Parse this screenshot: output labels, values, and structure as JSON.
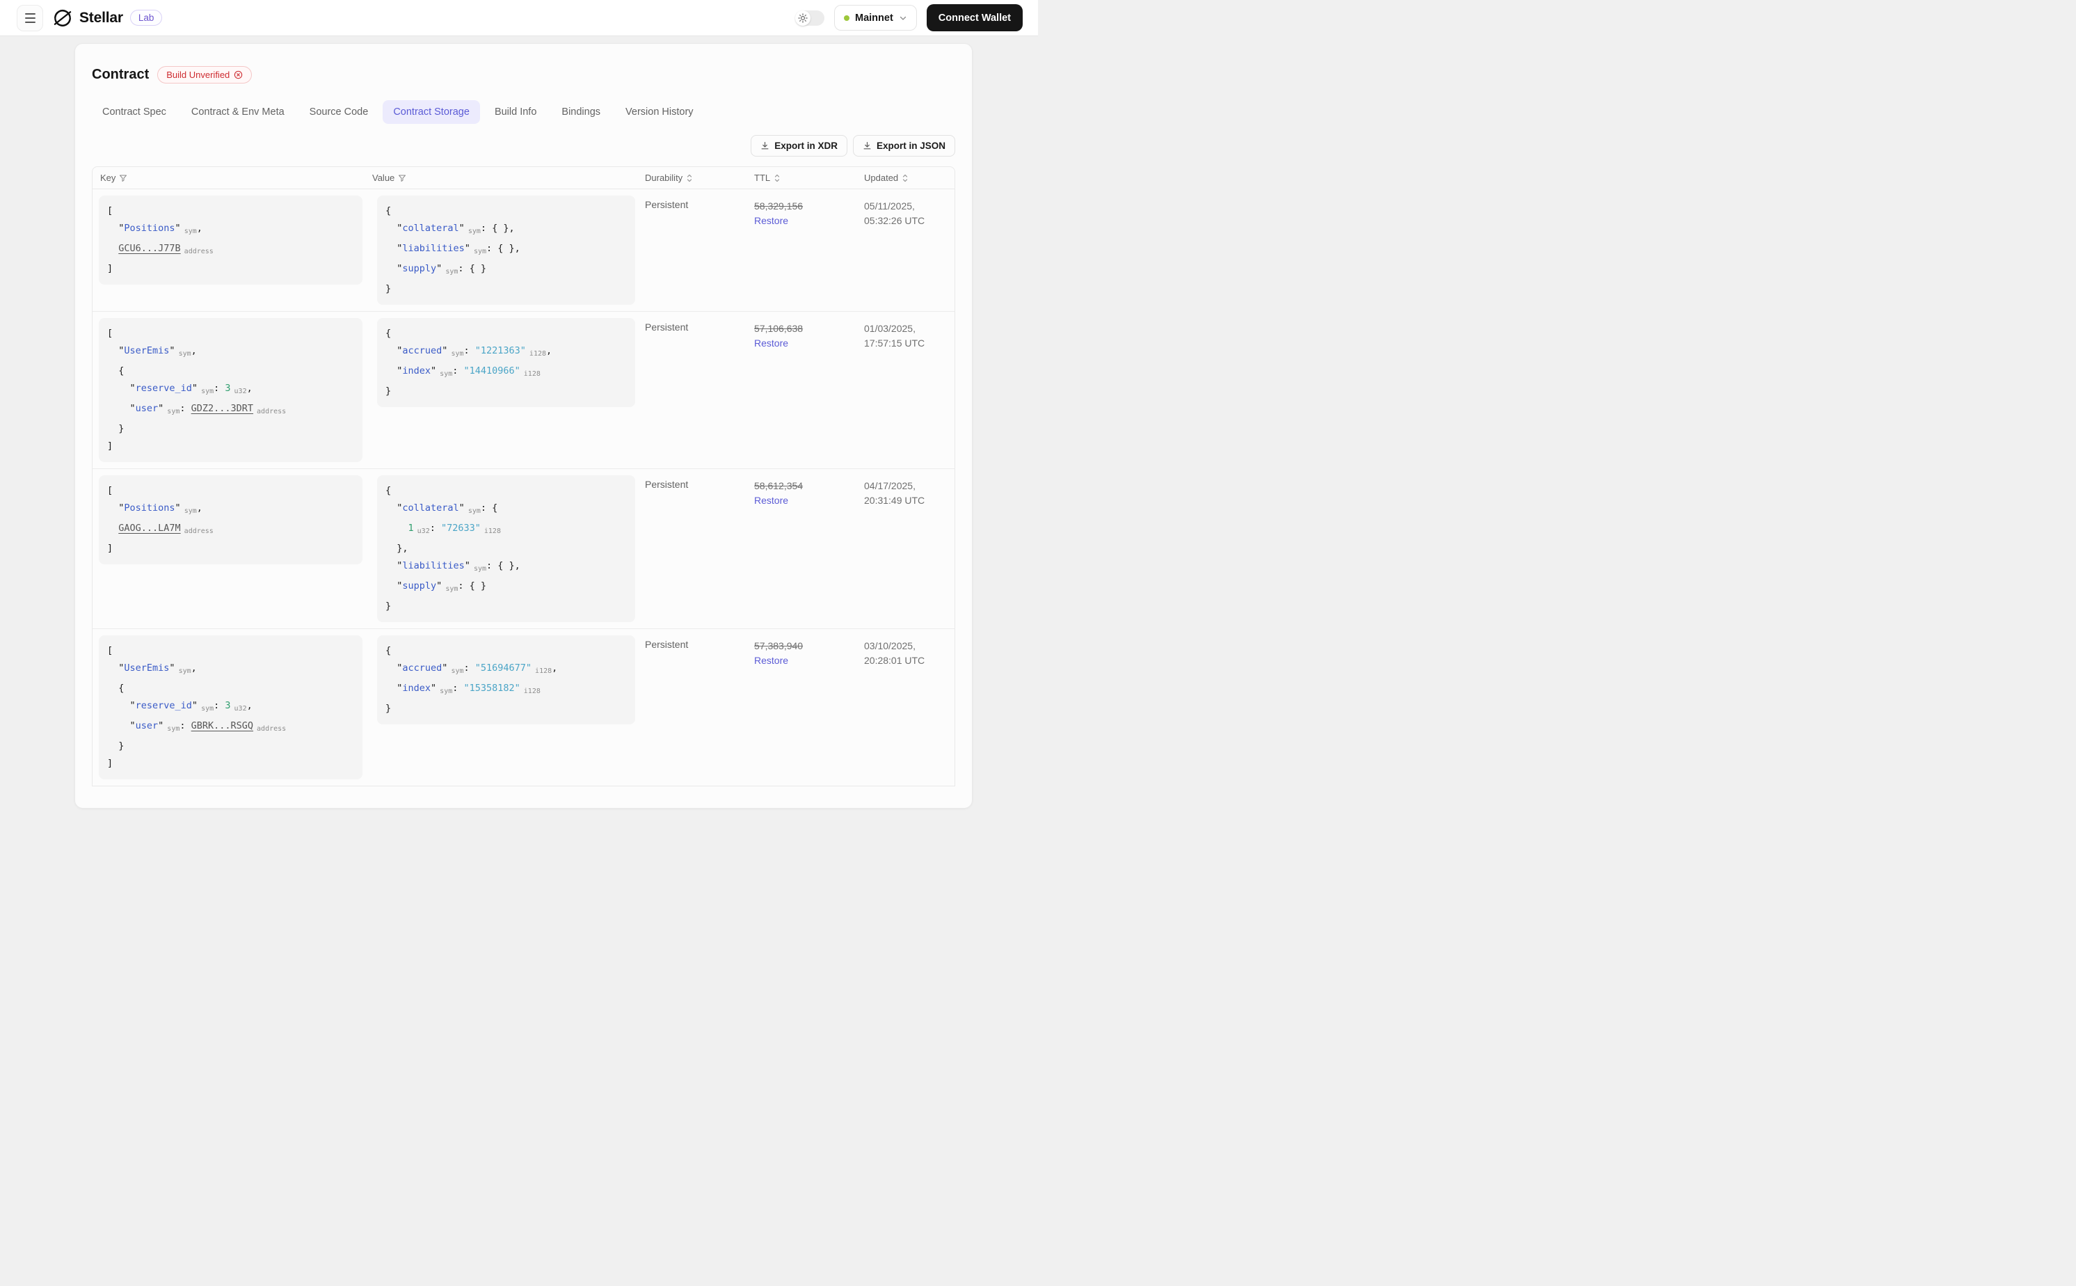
{
  "header": {
    "brand": "Stellar",
    "badge": "Lab",
    "network": {
      "label": "Mainnet",
      "status_color": "#9dc73b"
    },
    "connect_wallet_label": "Connect Wallet"
  },
  "page": {
    "title": "Contract",
    "status_badge": "Build Unverified",
    "tabs": [
      {
        "label": "Contract Spec",
        "active": false
      },
      {
        "label": "Contract & Env Meta",
        "active": false
      },
      {
        "label": "Source Code",
        "active": false
      },
      {
        "label": "Contract Storage",
        "active": true
      },
      {
        "label": "Build Info",
        "active": false
      },
      {
        "label": "Bindings",
        "active": false
      },
      {
        "label": "Version History",
        "active": false
      }
    ],
    "export_buttons": {
      "xdr": "Export in XDR",
      "json": "Export in JSON"
    }
  },
  "colors": {
    "accent_purple": "#5b5bd6",
    "badge_red": "#ce2c31",
    "code_key_blue": "#3a5bc7",
    "code_string_cyan": "#4ba5c7",
    "code_number_green": "#2f9e6e"
  },
  "table": {
    "columns": [
      {
        "label": "Key",
        "icon": "filter"
      },
      {
        "label": "Value",
        "icon": "filter"
      },
      {
        "label": "Durability",
        "icon": "sort"
      },
      {
        "label": "TTL",
        "icon": "sort"
      },
      {
        "label": "Updated",
        "icon": "sort"
      }
    ],
    "rows": [
      {
        "key_lines": [
          [
            {
              "t": "p",
              "v": "["
            }
          ],
          [
            {
              "t": "p",
              "v": "  \""
            },
            {
              "t": "k",
              "v": "Positions"
            },
            {
              "t": "p",
              "v": "\""
            },
            {
              "t": "a",
              "v": "sym"
            },
            {
              "t": "p",
              "v": ","
            }
          ],
          [
            {
              "t": "p",
              "v": "  "
            },
            {
              "t": "link",
              "v": "GCU6...J77B"
            },
            {
              "t": "a",
              "v": "address"
            }
          ],
          [
            {
              "t": "p",
              "v": "]"
            }
          ]
        ],
        "value_lines": [
          [
            {
              "t": "p",
              "v": "{"
            }
          ],
          [
            {
              "t": "p",
              "v": "  \""
            },
            {
              "t": "k",
              "v": "collateral"
            },
            {
              "t": "p",
              "v": "\""
            },
            {
              "t": "a",
              "v": "sym"
            },
            {
              "t": "p",
              "v": ": { },"
            }
          ],
          [
            {
              "t": "p",
              "v": "  \""
            },
            {
              "t": "k",
              "v": "liabilities"
            },
            {
              "t": "p",
              "v": "\""
            },
            {
              "t": "a",
              "v": "sym"
            },
            {
              "t": "p",
              "v": ": { },"
            }
          ],
          [
            {
              "t": "p",
              "v": "  \""
            },
            {
              "t": "k",
              "v": "supply"
            },
            {
              "t": "p",
              "v": "\""
            },
            {
              "t": "a",
              "v": "sym"
            },
            {
              "t": "p",
              "v": ": { }"
            }
          ],
          [
            {
              "t": "p",
              "v": "}"
            }
          ]
        ],
        "durability": "Persistent",
        "ttl": "58,329,156",
        "ttl_action": "Restore",
        "updated": [
          "05/11/2025,",
          "05:32:26 UTC"
        ]
      },
      {
        "key_lines": [
          [
            {
              "t": "p",
              "v": "["
            }
          ],
          [
            {
              "t": "p",
              "v": "  \""
            },
            {
              "t": "k",
              "v": "UserEmis"
            },
            {
              "t": "p",
              "v": "\""
            },
            {
              "t": "a",
              "v": "sym"
            },
            {
              "t": "p",
              "v": ","
            }
          ],
          [
            {
              "t": "p",
              "v": "  {"
            }
          ],
          [
            {
              "t": "p",
              "v": "    \""
            },
            {
              "t": "k",
              "v": "reserve_id"
            },
            {
              "t": "p",
              "v": "\""
            },
            {
              "t": "a",
              "v": "sym"
            },
            {
              "t": "p",
              "v": ": "
            },
            {
              "t": "n",
              "v": "3"
            },
            {
              "t": "a",
              "v": "u32"
            },
            {
              "t": "p",
              "v": ","
            }
          ],
          [
            {
              "t": "p",
              "v": "    \""
            },
            {
              "t": "k",
              "v": "user"
            },
            {
              "t": "p",
              "v": "\""
            },
            {
              "t": "a",
              "v": "sym"
            },
            {
              "t": "p",
              "v": ": "
            },
            {
              "t": "link",
              "v": "GDZ2...3DRT"
            },
            {
              "t": "a",
              "v": "address"
            }
          ],
          [
            {
              "t": "p",
              "v": "  }"
            }
          ],
          [
            {
              "t": "p",
              "v": "]"
            }
          ]
        ],
        "value_lines": [
          [
            {
              "t": "p",
              "v": "{"
            }
          ],
          [
            {
              "t": "p",
              "v": "  \""
            },
            {
              "t": "k",
              "v": "accrued"
            },
            {
              "t": "p",
              "v": "\""
            },
            {
              "t": "a",
              "v": "sym"
            },
            {
              "t": "p",
              "v": ": "
            },
            {
              "t": "s",
              "v": "\"1221363\""
            },
            {
              "t": "a",
              "v": "i128"
            },
            {
              "t": "p",
              "v": ","
            }
          ],
          [
            {
              "t": "p",
              "v": "  \""
            },
            {
              "t": "k",
              "v": "index"
            },
            {
              "t": "p",
              "v": "\""
            },
            {
              "t": "a",
              "v": "sym"
            },
            {
              "t": "p",
              "v": ": "
            },
            {
              "t": "s",
              "v": "\"14410966\""
            },
            {
              "t": "a",
              "v": "i128"
            }
          ],
          [
            {
              "t": "p",
              "v": "}"
            }
          ]
        ],
        "durability": "Persistent",
        "ttl": "57,106,638",
        "ttl_action": "Restore",
        "updated": [
          "01/03/2025,",
          "17:57:15 UTC"
        ]
      },
      {
        "key_lines": [
          [
            {
              "t": "p",
              "v": "["
            }
          ],
          [
            {
              "t": "p",
              "v": "  \""
            },
            {
              "t": "k",
              "v": "Positions"
            },
            {
              "t": "p",
              "v": "\""
            },
            {
              "t": "a",
              "v": "sym"
            },
            {
              "t": "p",
              "v": ","
            }
          ],
          [
            {
              "t": "p",
              "v": "  "
            },
            {
              "t": "link",
              "v": "GAOG...LA7M"
            },
            {
              "t": "a",
              "v": "address"
            }
          ],
          [
            {
              "t": "p",
              "v": "]"
            }
          ]
        ],
        "value_lines": [
          [
            {
              "t": "p",
              "v": "{"
            }
          ],
          [
            {
              "t": "p",
              "v": "  \""
            },
            {
              "t": "k",
              "v": "collateral"
            },
            {
              "t": "p",
              "v": "\""
            },
            {
              "t": "a",
              "v": "sym"
            },
            {
              "t": "p",
              "v": ": {"
            }
          ],
          [
            {
              "t": "p",
              "v": "    "
            },
            {
              "t": "n",
              "v": "1"
            },
            {
              "t": "a",
              "v": "u32"
            },
            {
              "t": "p",
              "v": ": "
            },
            {
              "t": "s",
              "v": "\"72633\""
            },
            {
              "t": "a",
              "v": "i128"
            }
          ],
          [
            {
              "t": "p",
              "v": "  },"
            }
          ],
          [
            {
              "t": "p",
              "v": "  \""
            },
            {
              "t": "k",
              "v": "liabilities"
            },
            {
              "t": "p",
              "v": "\""
            },
            {
              "t": "a",
              "v": "sym"
            },
            {
              "t": "p",
              "v": ": { },"
            }
          ],
          [
            {
              "t": "p",
              "v": "  \""
            },
            {
              "t": "k",
              "v": "supply"
            },
            {
              "t": "p",
              "v": "\""
            },
            {
              "t": "a",
              "v": "sym"
            },
            {
              "t": "p",
              "v": ": { }"
            }
          ],
          [
            {
              "t": "p",
              "v": "}"
            }
          ]
        ],
        "durability": "Persistent",
        "ttl": "58,612,354",
        "ttl_action": "Restore",
        "updated": [
          "04/17/2025,",
          "20:31:49 UTC"
        ]
      },
      {
        "key_lines": [
          [
            {
              "t": "p",
              "v": "["
            }
          ],
          [
            {
              "t": "p",
              "v": "  \""
            },
            {
              "t": "k",
              "v": "UserEmis"
            },
            {
              "t": "p",
              "v": "\""
            },
            {
              "t": "a",
              "v": "sym"
            },
            {
              "t": "p",
              "v": ","
            }
          ],
          [
            {
              "t": "p",
              "v": "  {"
            }
          ],
          [
            {
              "t": "p",
              "v": "    \""
            },
            {
              "t": "k",
              "v": "reserve_id"
            },
            {
              "t": "p",
              "v": "\""
            },
            {
              "t": "a",
              "v": "sym"
            },
            {
              "t": "p",
              "v": ": "
            },
            {
              "t": "n",
              "v": "3"
            },
            {
              "t": "a",
              "v": "u32"
            },
            {
              "t": "p",
              "v": ","
            }
          ],
          [
            {
              "t": "p",
              "v": "    \""
            },
            {
              "t": "k",
              "v": "user"
            },
            {
              "t": "p",
              "v": "\""
            },
            {
              "t": "a",
              "v": "sym"
            },
            {
              "t": "p",
              "v": ": "
            },
            {
              "t": "link",
              "v": "GBRK...RSGQ"
            },
            {
              "t": "a",
              "v": "address"
            }
          ],
          [
            {
              "t": "p",
              "v": "  }"
            }
          ],
          [
            {
              "t": "p",
              "v": "]"
            }
          ]
        ],
        "value_lines": [
          [
            {
              "t": "p",
              "v": "{"
            }
          ],
          [
            {
              "t": "p",
              "v": "  \""
            },
            {
              "t": "k",
              "v": "accrued"
            },
            {
              "t": "p",
              "v": "\""
            },
            {
              "t": "a",
              "v": "sym"
            },
            {
              "t": "p",
              "v": ": "
            },
            {
              "t": "s",
              "v": "\"51694677\""
            },
            {
              "t": "a",
              "v": "i128"
            },
            {
              "t": "p",
              "v": ","
            }
          ],
          [
            {
              "t": "p",
              "v": "  \""
            },
            {
              "t": "k",
              "v": "index"
            },
            {
              "t": "p",
              "v": "\""
            },
            {
              "t": "a",
              "v": "sym"
            },
            {
              "t": "p",
              "v": ": "
            },
            {
              "t": "s",
              "v": "\"15358182\""
            },
            {
              "t": "a",
              "v": "i128"
            }
          ],
          [
            {
              "t": "p",
              "v": "}"
            }
          ]
        ],
        "durability": "Persistent",
        "ttl": "57,383,940",
        "ttl_action": "Restore",
        "updated": [
          "03/10/2025,",
          "20:28:01 UTC"
        ]
      }
    ]
  }
}
